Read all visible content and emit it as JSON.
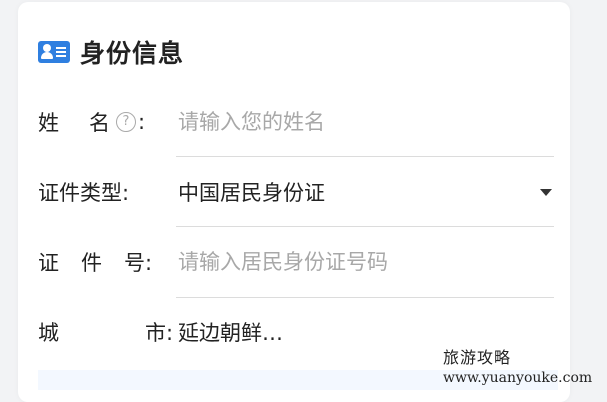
{
  "section": {
    "title": "身份信息",
    "icon": "id-card-icon"
  },
  "fields": {
    "name": {
      "label_char1": "姓",
      "label_char2": "名",
      "label_suffix": ":",
      "placeholder": "请输入您的姓名",
      "value": ""
    },
    "id_type": {
      "label": "证件类型:",
      "value": "中国居民身份证"
    },
    "id_number": {
      "label_char1": "证",
      "label_char2": "件",
      "label_char3": "号:",
      "placeholder": "请输入居民身份证号码",
      "value": ""
    },
    "city": {
      "label_char1": "城",
      "label_char2": "市:",
      "value": "延边朝鲜…"
    }
  },
  "watermark": {
    "line1": "旅游攻略",
    "line2": "www.yuanyouke.com"
  },
  "colors": {
    "accent": "#2f7fe0",
    "placeholder": "#a8a8a8",
    "divider": "#dcdcdc"
  }
}
